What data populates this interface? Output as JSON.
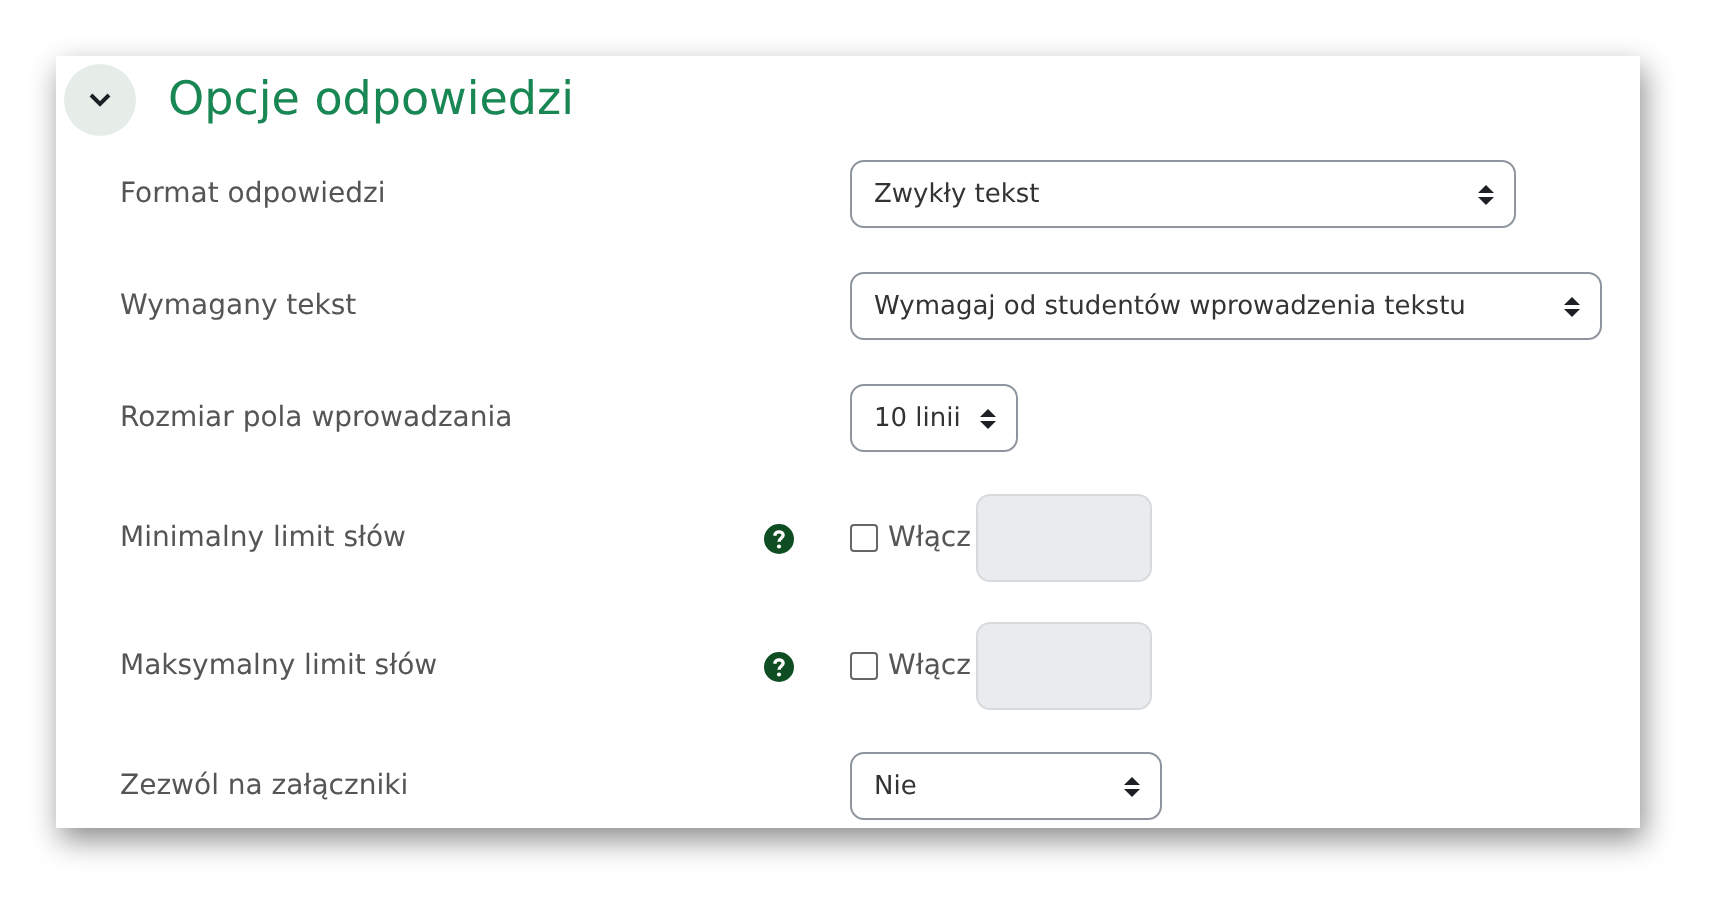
{
  "section": {
    "title": "Opcje odpowiedzi",
    "expanded": true
  },
  "rows": [
    {
      "kind": "select",
      "label": "Format odpowiedzi",
      "value": "Zwykły tekst"
    },
    {
      "kind": "select",
      "label": "Wymagany tekst",
      "value": "Wymagaj od studentów wprowadzenia tekstu"
    },
    {
      "kind": "select",
      "label": "Rozmiar pola wprowadzania",
      "value": "10 linii"
    },
    {
      "kind": "limit",
      "label": "Minimalny limit słów",
      "help": true,
      "checkbox_label": "Włącz",
      "checked": false
    },
    {
      "kind": "limit",
      "label": "Maksymalny limit słów",
      "help": true,
      "checkbox_label": "Włącz",
      "checked": false
    },
    {
      "kind": "select",
      "label": "Zezwól na załączniki",
      "value": "Nie"
    }
  ]
}
